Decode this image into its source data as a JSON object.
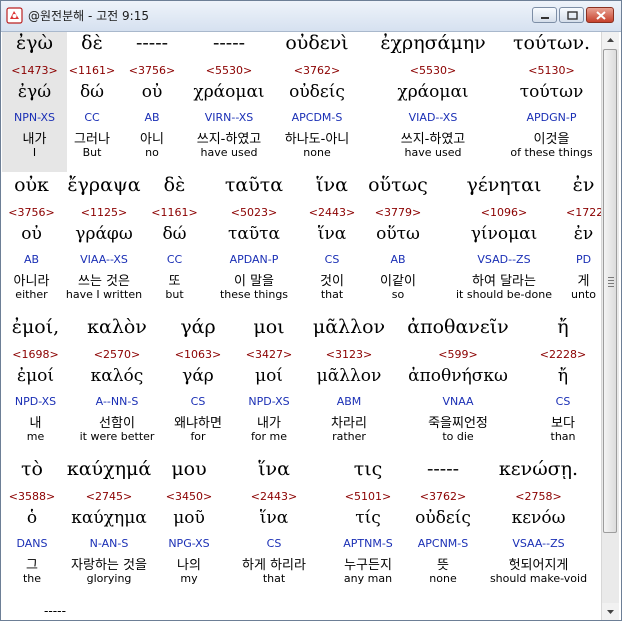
{
  "window": {
    "title": "@원전분해 - 고전 9:15",
    "controls": {
      "minimize_icon": "minimize-icon",
      "maximize_icon": "maximize-icon",
      "close_icon": "close-icon"
    }
  },
  "rows": [
    {
      "words": [
        {
          "greek": "ἐγὼ",
          "num": "<1473>",
          "lemma": "ἐγώ",
          "parse": "NPN-XS",
          "kor": "내가",
          "eng": "I"
        },
        {
          "greek": "δὲ",
          "num": "<1161>",
          "lemma": "δώ",
          "parse": "CC",
          "kor": "그러나",
          "eng": "But"
        },
        {
          "greek": "-----",
          "num": "<3756>",
          "lemma": "οὐ",
          "parse": "AB",
          "kor": "아니",
          "eng": "no"
        },
        {
          "greek": "-----",
          "num": "<5530>",
          "lemma": "χράομαι",
          "parse": "VIRN--XS",
          "kor": "쓰지-하였고",
          "eng": "have used"
        },
        {
          "greek": "οὐδενὶ",
          "num": "<3762>",
          "lemma": "οὐδείς",
          "parse": "APCDM-S",
          "kor": "하나도-아니",
          "eng": "none"
        },
        {
          "greek": "ἐχρησάμην",
          "num": "<5530>",
          "lemma": "χράομαι",
          "parse": "VIAD--XS",
          "kor": "쓰지-하였고",
          "eng": "have used"
        },
        {
          "greek": "τούτων.",
          "num": "<5130>",
          "lemma": "τούτων",
          "parse": "APDGN-P",
          "kor": "이것을",
          "eng": "of these things"
        }
      ]
    },
    {
      "words": [
        {
          "greek": "οὐκ",
          "num": "<3756>",
          "lemma": "οὐ",
          "parse": "AB",
          "kor": "아니라",
          "eng": "either"
        },
        {
          "greek": "ἔγραψα",
          "num": "<1125>",
          "lemma": "γράφω",
          "parse": "VIAA--XS",
          "kor": "쓰는 것은",
          "eng": "have I written"
        },
        {
          "greek": "δὲ",
          "num": "<1161>",
          "lemma": "δώ",
          "parse": "CC",
          "kor": "또",
          "eng": "but"
        },
        {
          "greek": "ταῦτα",
          "num": "<5023>",
          "lemma": "ταῦτα",
          "parse": "APDAN-P",
          "kor": "이 말을",
          "eng": "these things"
        },
        {
          "greek": "ἵνα",
          "num": "<2443>",
          "lemma": "ἵνα",
          "parse": "CS",
          "kor": "것이",
          "eng": "that"
        },
        {
          "greek": "οὕτως",
          "num": "<3779>",
          "lemma": "οὕτω",
          "parse": "AB",
          "kor": "이같이",
          "eng": "so"
        },
        {
          "greek": "γένηται",
          "num": "<1096>",
          "lemma": "γίνομαι",
          "parse": "VSAD--ZS",
          "kor": "하여 달라는",
          "eng": "it should be-done"
        },
        {
          "greek": "ἐν",
          "num": "<1722>",
          "lemma": "ἐν",
          "parse": "PD",
          "kor": "게",
          "eng": "unto"
        }
      ]
    },
    {
      "words": [
        {
          "greek": "ἐμοί,",
          "num": "<1698>",
          "lemma": "ἐμοί",
          "parse": "NPD-XS",
          "kor": "내",
          "eng": "me"
        },
        {
          "greek": "καλὸν",
          "num": "<2570>",
          "lemma": "καλός",
          "parse": "A--NN-S",
          "kor": "선함이",
          "eng": "it were better"
        },
        {
          "greek": "γάρ",
          "num": "<1063>",
          "lemma": "γάρ",
          "parse": "CS",
          "kor": "왜냐하면",
          "eng": "for"
        },
        {
          "greek": "μοι",
          "num": "<3427>",
          "lemma": "μοί",
          "parse": "NPD-XS",
          "kor": "내가",
          "eng": "for me"
        },
        {
          "greek": "μᾶλλον",
          "num": "<3123>",
          "lemma": "μᾶλλον",
          "parse": "ABM",
          "kor": "차라리",
          "eng": "rather"
        },
        {
          "greek": "ἀποθανεῖν",
          "num": "<599>",
          "lemma": "ἀποθνήσκω",
          "parse": "VNAA",
          "kor": "죽을찌언정",
          "eng": "to die"
        },
        {
          "greek": "ἤ",
          "num": "<2228>",
          "lemma": "ἤ",
          "parse": "CS",
          "kor": "보다",
          "eng": "than"
        }
      ]
    },
    {
      "words": [
        {
          "greek": "τὸ",
          "num": "<3588>",
          "lemma": "ὁ",
          "parse": "DANS",
          "kor": "그",
          "eng": "the"
        },
        {
          "greek": "καύχημά",
          "num": "<2745>",
          "lemma": "καύχημα",
          "parse": "N-AN-S",
          "kor": "자랑하는 것을",
          "eng": "glorying"
        },
        {
          "greek": "μου",
          "num": "<3450>",
          "lemma": "μοῦ",
          "parse": "NPG-XS",
          "kor": "나의",
          "eng": "my"
        },
        {
          "greek": "ἵνα",
          "num": "<2443>",
          "lemma": "ἵνα",
          "parse": "CS",
          "kor": "하게 하리라",
          "eng": "that"
        },
        {
          "greek": "τις",
          "num": "<5101>",
          "lemma": "τίς",
          "parse": "APTNM-S",
          "kor": "누구든지",
          "eng": "any man"
        },
        {
          "greek": "-----",
          "num": "<3762>",
          "lemma": "οὐδείς",
          "parse": "APCNM-S",
          "kor": "뜻",
          "eng": "none"
        },
        {
          "greek": "κενώσῃ.",
          "num": "<2758>",
          "lemma": "κενόω",
          "parse": "VSAA--ZS",
          "kor": "헛되어지게",
          "eng": "should make-void"
        }
      ]
    }
  ],
  "trailing_text": "-----"
}
